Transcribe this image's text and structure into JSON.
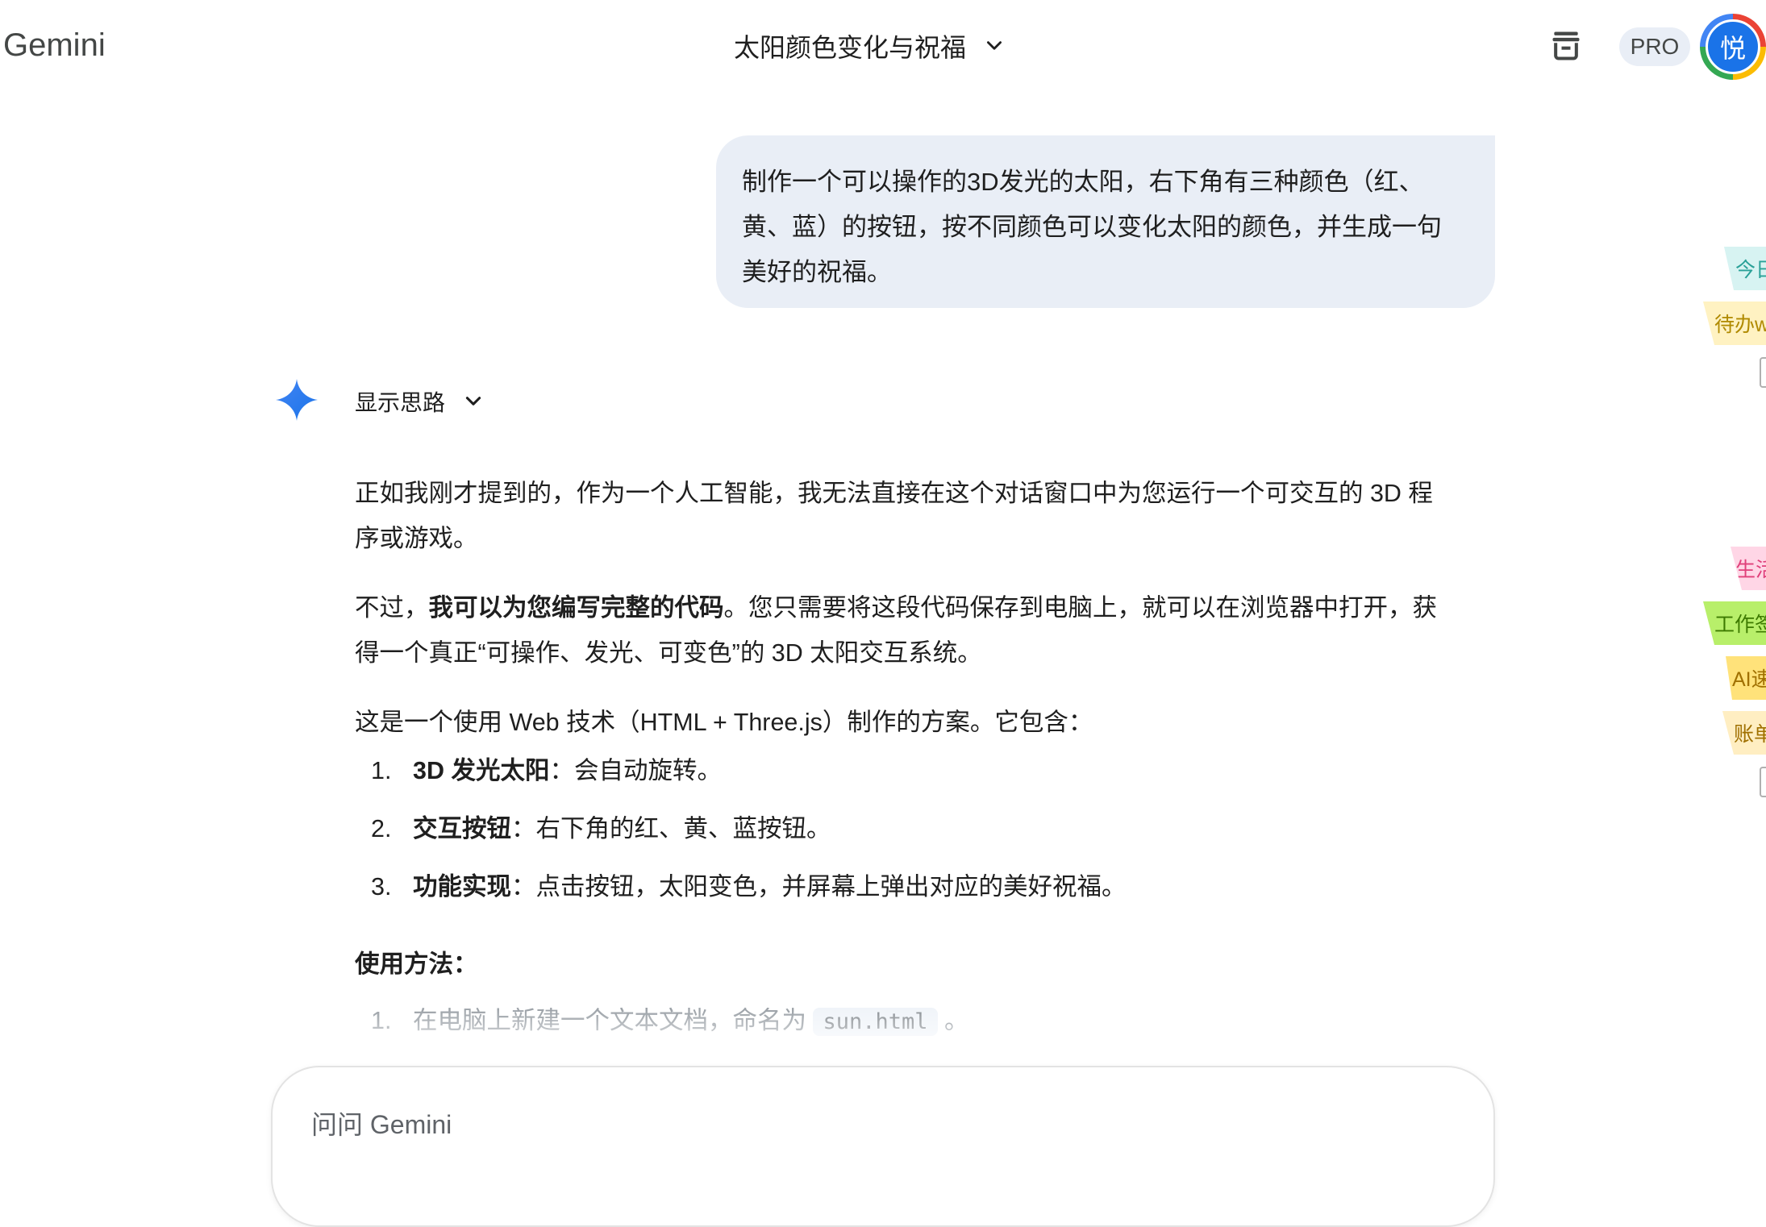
{
  "header": {
    "logo": "Gemini",
    "conversation_title": "太阳颜色变化与祝福",
    "pro_label": "PRO",
    "avatar_initial": "悦"
  },
  "user_message": {
    "lines": [
      "制作一个可以操作的3D发光的太阳，右下角有三种颜色（红、",
      "黄、蓝）的按钮，按不同颜色可以变化太阳的颜色，并生成一句",
      "美好的祝福。"
    ]
  },
  "response": {
    "thoughts_label": "显示思路",
    "p1_lines": [
      "正如我刚才提到的，作为一个人工智能，我无法直接在这个对话窗口中为您运行一个可交互的 3D 程",
      "序或游戏。"
    ],
    "p2": {
      "prefix": "不过，",
      "bold": "我可以为您编写完整的代码",
      "line1_rest": "。您只需要将这段代码保存到电脑上，就可以在浏览器中打开，获",
      "line2": "得一个真正“可操作、发光、可变色”的 3D 太阳交互系统。"
    },
    "p3": "这是一个使用 Web 技术（HTML + Three.js）制作的方案。它包含：",
    "features": [
      {
        "num": "1.",
        "title": "3D 发光太阳",
        "desc": "：会自动旋转。"
      },
      {
        "num": "2.",
        "title": "交互按钮",
        "desc": "：右下角的红、黄、蓝按钮。"
      },
      {
        "num": "3.",
        "title": "功能实现",
        "desc": "：点击按钮，太阳变色，并屏幕上弹出对应的美好祝福。"
      }
    ],
    "usage_heading": "使用方法：",
    "usage_steps": [
      {
        "num": "1.",
        "text": "在电脑上新建一个文本文档，命名为 ",
        "code": "sun.html",
        "suffix": " 。"
      }
    ]
  },
  "input": {
    "placeholder": "问问 Gemini"
  },
  "side_tags": [
    {
      "label": "今日",
      "color": "#d7f3f2",
      "text_color": "#2aa198"
    },
    {
      "label": "待办w",
      "color": "#fff2c2",
      "text_color": "#b08a00"
    },
    {
      "label": "生活",
      "color": "#ffd6e6",
      "text_color": "#e0407a"
    },
    {
      "label": "工作签",
      "color": "#b8ef6a",
      "text_color": "#3d7a00"
    },
    {
      "label": "AI速",
      "color": "#ffe27a",
      "text_color": "#a07000"
    },
    {
      "label": "账单",
      "color": "#ffeec2",
      "text_color": "#a07000"
    }
  ]
}
